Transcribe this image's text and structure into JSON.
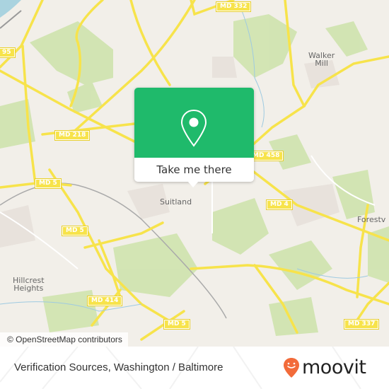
{
  "map": {
    "route_shields": [
      {
        "id": "md332",
        "label": "MD 332"
      },
      {
        "id": "i295",
        "label": "95"
      },
      {
        "id": "md218",
        "label": "MD 218"
      },
      {
        "id": "md458",
        "label": "MD 458"
      },
      {
        "id": "md5a",
        "label": "MD 5"
      },
      {
        "id": "md5b",
        "label": "MD 5"
      },
      {
        "id": "md4",
        "label": "MD 4"
      },
      {
        "id": "md414",
        "label": "MD 414"
      },
      {
        "id": "md5c",
        "label": "MD 5"
      },
      {
        "id": "md337",
        "label": "MD 337"
      }
    ],
    "places": [
      {
        "id": "walker-mill",
        "label": "Walker\nMill"
      },
      {
        "id": "suitland",
        "label": "Suitland"
      },
      {
        "id": "forestville",
        "label": "Forestv"
      },
      {
        "id": "hillcrest",
        "label": "Hillcrest\nHeights"
      }
    ],
    "popup": {
      "button_label": "Take me there",
      "icon": "map-pin-icon"
    },
    "attribution": "© OpenStreetMap contributors"
  },
  "footer": {
    "title": "Verification Sources, Washington / Baltimore",
    "logo_text": "moovit",
    "logo_icon": "moovit-smile-pin-icon",
    "brand_color": "#f26b3a"
  },
  "colors": {
    "popup_green": "#1fba6b",
    "road_yellow": "#f7e34b",
    "park_green": "#c8dfa6"
  }
}
